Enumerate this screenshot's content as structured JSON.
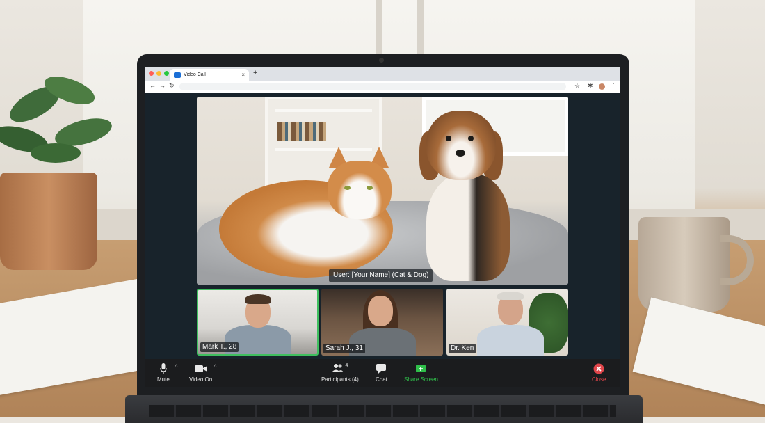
{
  "browser": {
    "tab_title": "Video Call",
    "tab_close": "×",
    "new_tab": "+",
    "nav_back": "←",
    "nav_forward": "→",
    "nav_reload": "↻",
    "star": "☆",
    "extensions": "✱",
    "menu": "⋮"
  },
  "call": {
    "main_label": "User: [Your Name] (Cat & Dog)",
    "participants": [
      {
        "label": "Mark T., 28",
        "active": true
      },
      {
        "label": "Sarah J., 31",
        "active": false
      },
      {
        "label": "Dr. Ken",
        "active": false
      }
    ]
  },
  "controls": {
    "mute": {
      "icon": "mic-icon",
      "label": "Mute"
    },
    "video": {
      "icon": "camera-icon",
      "label": "Video On"
    },
    "participants": {
      "icon": "people-icon",
      "label": "Participants (4)",
      "count": "4"
    },
    "chat": {
      "icon": "chat-icon",
      "label": "Chat"
    },
    "share": {
      "icon": "share-screen-icon",
      "label": "Share Screen"
    },
    "close": {
      "icon": "close-icon",
      "label": "Close"
    },
    "caret": "^"
  },
  "colors": {
    "share": "#2fbf4a",
    "close": "#e0454a",
    "active_border": "#3fbf5f",
    "favicon": "#1b6fd6"
  }
}
